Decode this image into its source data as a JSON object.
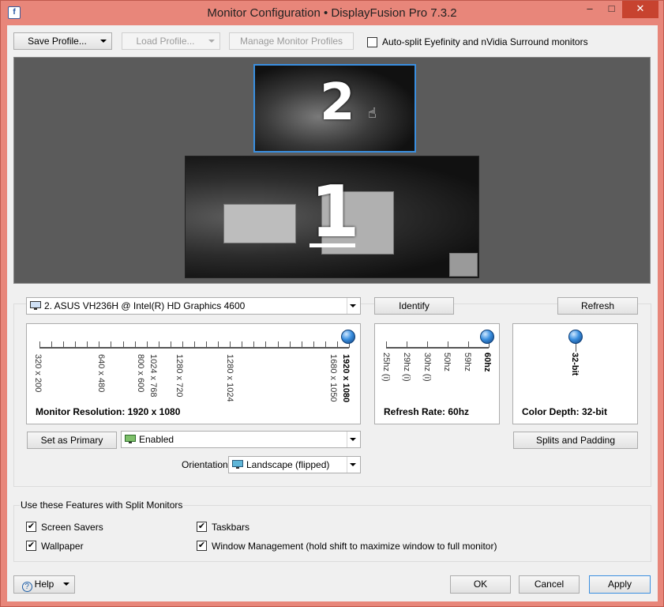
{
  "window": {
    "title": "Monitor Configuration • DisplayFusion Pro 7.3.2",
    "minimize": "–",
    "maximize": "□",
    "close": "✕"
  },
  "toolbar": {
    "save_profile": "Save Profile...",
    "load_profile": "Load Profile...",
    "manage_profiles": "Manage Monitor Profiles",
    "auto_split_label": "Auto-split Eyefinity and nVidia Surround monitors",
    "auto_split_checked": false
  },
  "preview": {
    "monitor2_number": "2",
    "monitor1_number": "1"
  },
  "monitor_settings": {
    "selected_monitor": "2. ASUS VH236H @ Intel(R) HD Graphics 4600",
    "identify": "Identify",
    "refresh": "Refresh",
    "resolution": {
      "ticks": [
        "320 x 200",
        "640 x 480",
        "800 x 600",
        "1024 x 768",
        "1280 x 720",
        "1280 x 1024",
        "1680 x 1050",
        "1920 x 1080"
      ],
      "selected": "1920 x 1080",
      "caption": "Monitor Resolution: 1920 x 1080"
    },
    "refresh_rate": {
      "ticks": [
        "25hz (i)",
        "29hz (i)",
        "30hz (i)",
        "50hz",
        "59hz",
        "60hz"
      ],
      "selected": "60hz",
      "caption": "Refresh Rate: 60hz"
    },
    "color_depth": {
      "ticks": [
        "32-bit"
      ],
      "selected": "32-bit",
      "caption": "Color Depth: 32-bit"
    },
    "set_primary": "Set as Primary",
    "enabled_value": "Enabled",
    "splits_padding": "Splits and Padding",
    "orientation_label": "Orientation:",
    "orientation_value": "Landscape (flipped)"
  },
  "split_features": {
    "title": "Use these Features with Split Monitors",
    "screen_savers": "Screen Savers",
    "taskbars": "Taskbars",
    "wallpaper": "Wallpaper",
    "window_management": "Window Management (hold shift to maximize window to full monitor)",
    "check": "✔"
  },
  "footer": {
    "help": "Help",
    "ok": "OK",
    "cancel": "Cancel",
    "apply": "Apply"
  },
  "colors": {
    "titlebar": "#e8867a",
    "close": "#c7432f",
    "selected_border": "#3a8fe0",
    "knob": "#3a8fe0"
  }
}
